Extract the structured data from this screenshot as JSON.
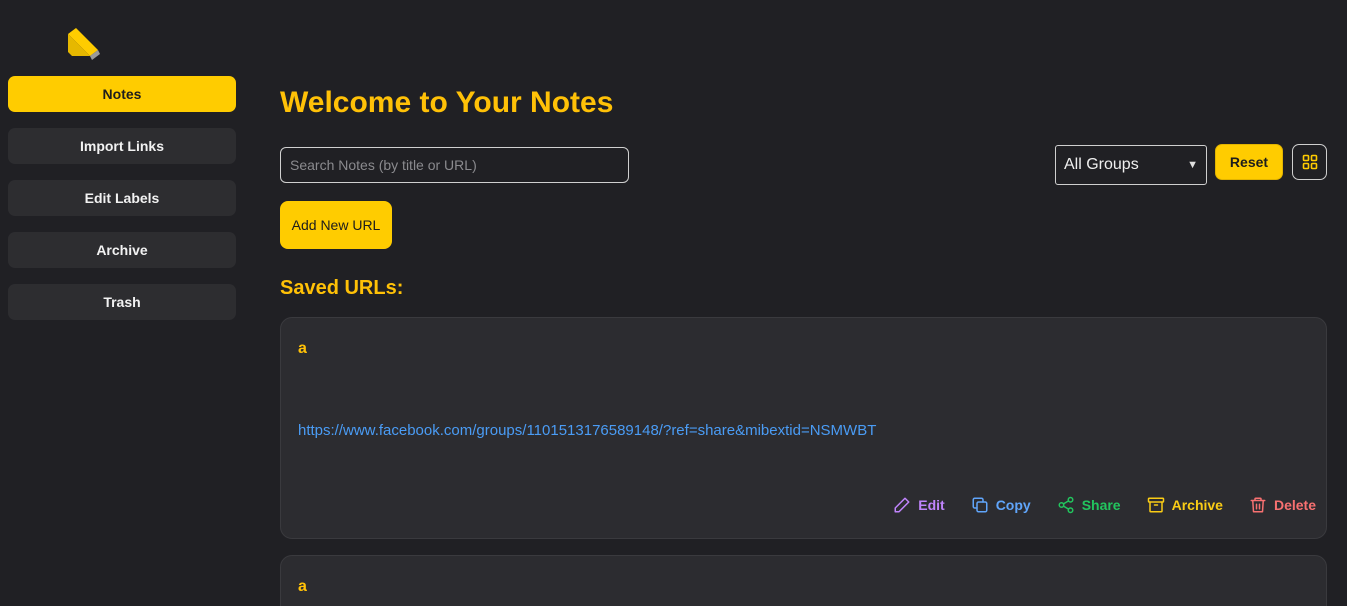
{
  "sidebar": {
    "items": [
      {
        "label": "Notes",
        "active": true
      },
      {
        "label": "Import Links",
        "active": false
      },
      {
        "label": "Edit Labels",
        "active": false
      },
      {
        "label": "Archive",
        "active": false
      },
      {
        "label": "Trash",
        "active": false
      }
    ]
  },
  "main": {
    "title": "Welcome to Your Notes",
    "search_placeholder": "Search Notes (by title or URL)",
    "group_filter": {
      "selected": "All Groups"
    },
    "reset_label": "Reset",
    "add_label": "Add New URL",
    "saved_heading": "Saved URLs:"
  },
  "cards": [
    {
      "title": "a",
      "url": "https://www.facebook.com/groups/1101513176589148/?ref=share&mibextid=NSMWBT"
    },
    {
      "title": "a",
      "url": ""
    }
  ],
  "actions": {
    "edit": "Edit",
    "copy": "Copy",
    "share": "Share",
    "archive": "Archive",
    "delete": "Delete"
  },
  "colors": {
    "background": "#202024",
    "accent": "#ffcc00",
    "card": "#2c2c30",
    "link": "#4a9cf5",
    "edit": "#c084fc",
    "copy": "#60a5fa",
    "share": "#22c55e",
    "archive": "#facc15",
    "delete": "#f87171"
  },
  "icons": [
    "logo-icon",
    "grid-view-icon",
    "edit-icon",
    "copy-icon",
    "share-icon",
    "archive-icon",
    "delete-icon"
  ]
}
